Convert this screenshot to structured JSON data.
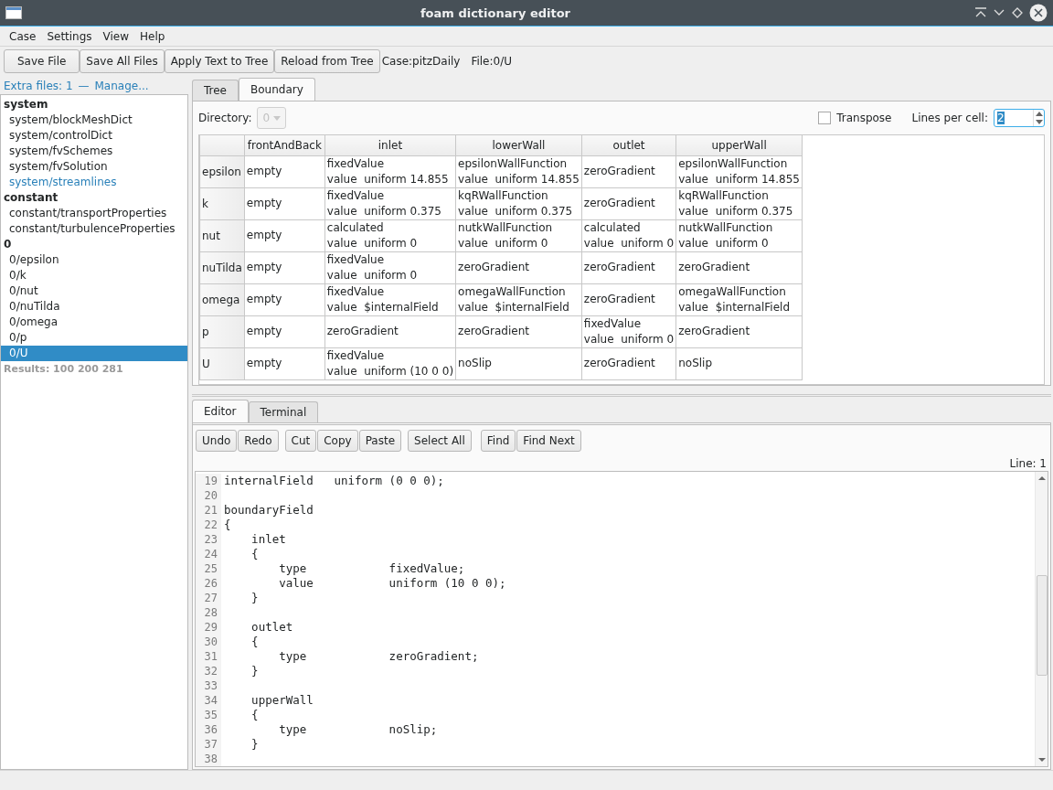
{
  "window": {
    "title": "foam dictionary editor"
  },
  "menu": [
    "Case",
    "Settings",
    "View",
    "Help"
  ],
  "toolbar": {
    "buttons": [
      "Save File",
      "Save All Files",
      "Apply Text to Tree",
      "Reload from Tree"
    ],
    "case_label": "Case:pitzDaily",
    "file_label": "File:0/U"
  },
  "sidebar": {
    "extra_files": "Extra files: 1",
    "separator": "—",
    "manage_link": "Manage...",
    "tree": [
      {
        "label": "system",
        "children": [
          {
            "label": "system/blockMeshDict",
            "selected": false,
            "highlighted": false
          },
          {
            "label": "system/controlDict",
            "selected": false,
            "highlighted": false
          },
          {
            "label": "system/fvSchemes",
            "selected": false,
            "highlighted": false
          },
          {
            "label": "system/fvSolution",
            "selected": false,
            "highlighted": false
          },
          {
            "label": "system/streamlines",
            "selected": false,
            "highlighted": true
          }
        ]
      },
      {
        "label": "constant",
        "children": [
          {
            "label": "constant/transportProperties",
            "selected": false,
            "highlighted": false
          },
          {
            "label": "constant/turbulenceProperties",
            "selected": false,
            "highlighted": false
          }
        ]
      },
      {
        "label": "0",
        "children": [
          {
            "label": "0/epsilon",
            "selected": false,
            "highlighted": false
          },
          {
            "label": "0/k",
            "selected": false,
            "highlighted": false
          },
          {
            "label": "0/nut",
            "selected": false,
            "highlighted": false
          },
          {
            "label": "0/nuTilda",
            "selected": false,
            "highlighted": false
          },
          {
            "label": "0/omega",
            "selected": false,
            "highlighted": false
          },
          {
            "label": "0/p",
            "selected": false,
            "highlighted": false
          },
          {
            "label": "0/U",
            "selected": true,
            "highlighted": false
          }
        ]
      }
    ],
    "results": "Results: 100  200  281"
  },
  "top_tabs": [
    {
      "label": "Tree",
      "selected": false
    },
    {
      "label": "Boundary",
      "selected": true
    }
  ],
  "boundary": {
    "directory_label": "Directory:",
    "directory_value": "0",
    "directory_disabled": true,
    "transpose_label": "Transpose",
    "transpose_checked": false,
    "lines_label": "Lines per cell:",
    "lines_value": "2",
    "columns": [
      "frontAndBack",
      "inlet",
      "lowerWall",
      "outlet",
      "upperWall"
    ],
    "rows": [
      {
        "header": "epsilon",
        "cells": [
          [
            "empty"
          ],
          [
            "fixedValue",
            "value  uniform 14.855"
          ],
          [
            "epsilonWallFunction",
            "value  uniform 14.855"
          ],
          [
            "zeroGradient"
          ],
          [
            "epsilonWallFunction",
            "value  uniform 14.855"
          ]
        ]
      },
      {
        "header": "k",
        "cells": [
          [
            "empty"
          ],
          [
            "fixedValue",
            "value  uniform 0.375"
          ],
          [
            "kqRWallFunction",
            "value  uniform 0.375"
          ],
          [
            "zeroGradient"
          ],
          [
            "kqRWallFunction",
            "value  uniform 0.375"
          ]
        ]
      },
      {
        "header": "nut",
        "cells": [
          [
            "empty"
          ],
          [
            "calculated",
            "value  uniform 0"
          ],
          [
            "nutkWallFunction",
            "value  uniform 0"
          ],
          [
            "calculated",
            "value  uniform 0"
          ],
          [
            "nutkWallFunction",
            "value  uniform 0"
          ]
        ]
      },
      {
        "header": "nuTilda",
        "cells": [
          [
            "empty"
          ],
          [
            "fixedValue",
            "value  uniform 0"
          ],
          [
            "zeroGradient"
          ],
          [
            "zeroGradient"
          ],
          [
            "zeroGradient"
          ]
        ]
      },
      {
        "header": "omega",
        "cells": [
          [
            "empty"
          ],
          [
            "fixedValue",
            "value  $internalField"
          ],
          [
            "omegaWallFunction",
            "value  $internalField"
          ],
          [
            "zeroGradient"
          ],
          [
            "omegaWallFunction",
            "value  $internalField"
          ]
        ]
      },
      {
        "header": "p",
        "cells": [
          [
            "empty"
          ],
          [
            "zeroGradient"
          ],
          [
            "zeroGradient"
          ],
          [
            "fixedValue",
            "value  uniform 0"
          ],
          [
            "zeroGradient"
          ]
        ]
      },
      {
        "header": "U",
        "cells": [
          [
            "empty"
          ],
          [
            "fixedValue",
            "value  uniform (10 0 0)"
          ],
          [
            "noSlip"
          ],
          [
            "zeroGradient"
          ],
          [
            "noSlip"
          ]
        ]
      }
    ]
  },
  "bottom_tabs": [
    {
      "label": "Editor",
      "selected": true
    },
    {
      "label": "Terminal",
      "selected": false
    }
  ],
  "editor": {
    "button_groups": [
      [
        "Undo",
        "Redo"
      ],
      [
        "Cut",
        "Copy",
        "Paste"
      ],
      [
        "Select All"
      ],
      [
        "Find",
        "Find Next"
      ]
    ],
    "line_status": "Line: 1",
    "lines": [
      {
        "number": "19",
        "text": "internalField   uniform (0 0 0);"
      },
      {
        "number": "20"
      },
      {
        "number": "21",
        "text": "boundaryField"
      },
      {
        "number": "22",
        "text": "{"
      },
      {
        "number": "23",
        "text": "    inlet"
      },
      {
        "number": "24",
        "text": "    {"
      },
      {
        "number": "25",
        "text": "        type            fixedValue;"
      },
      {
        "number": "26",
        "text": "        value           uniform (10 0 0);"
      },
      {
        "number": "27",
        "text": "    }"
      },
      {
        "number": "28"
      },
      {
        "number": "29",
        "text": "    outlet"
      },
      {
        "number": "30",
        "text": "    {"
      },
      {
        "number": "31",
        "text": "        type            zeroGradient;"
      },
      {
        "number": "32",
        "text": "    }"
      },
      {
        "number": "33"
      },
      {
        "number": "34",
        "text": "    upperWall"
      },
      {
        "number": "35",
        "text": "    {"
      },
      {
        "number": "36",
        "text": "        type            noSlip;"
      },
      {
        "number": "37",
        "text": "    }"
      },
      {
        "number": "38"
      }
    ]
  }
}
